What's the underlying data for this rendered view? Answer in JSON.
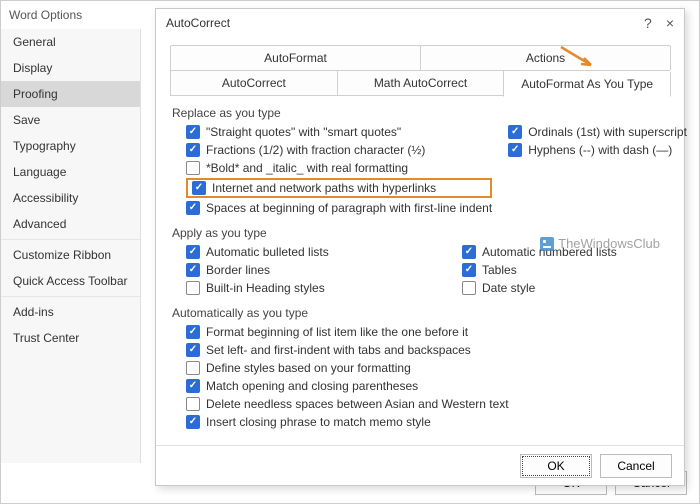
{
  "word_options": {
    "title": "Word Options",
    "sidebar": {
      "items": [
        "General",
        "Display",
        "Proofing",
        "Save",
        "Typography",
        "Language",
        "Accessibility",
        "Advanced"
      ],
      "items2": [
        "Customize Ribbon",
        "Quick Access Toolbar"
      ],
      "items3": [
        "Add-ins",
        "Trust Center"
      ],
      "active": "Proofing"
    },
    "footer": {
      "ok": "OK",
      "cancel": "Cancel"
    }
  },
  "autocorrect": {
    "title": "AutoCorrect",
    "tabs_row1": [
      "AutoFormat",
      "Actions"
    ],
    "tabs_row2": [
      "AutoCorrect",
      "Math AutoCorrect",
      "AutoFormat As You Type"
    ],
    "active_tab": "AutoFormat As You Type",
    "sections": {
      "replace": {
        "label": "Replace as you type",
        "left": [
          {
            "label": "\"Straight quotes\" with \"smart quotes\"",
            "checked": true
          },
          {
            "label": "Fractions (1/2) with fraction character (½)",
            "checked": true
          },
          {
            "label": "*Bold* and _italic_ with real formatting",
            "checked": false
          },
          {
            "label": "Internet and network paths with hyperlinks",
            "checked": true,
            "highlight": true
          },
          {
            "label": "Spaces at beginning of paragraph with first-line indent",
            "checked": true
          }
        ],
        "right": [
          {
            "label": "Ordinals (1st) with superscript",
            "checked": true
          },
          {
            "label": "Hyphens (--) with dash (—)",
            "checked": true
          }
        ]
      },
      "apply": {
        "label": "Apply as you type",
        "left": [
          {
            "label": "Automatic bulleted lists",
            "checked": true
          },
          {
            "label": "Border lines",
            "checked": true
          },
          {
            "label": "Built-in Heading styles",
            "checked": false
          }
        ],
        "right": [
          {
            "label": "Automatic numbered lists",
            "checked": true
          },
          {
            "label": "Tables",
            "checked": true
          },
          {
            "label": "Date style",
            "checked": false
          }
        ]
      },
      "auto": {
        "label": "Automatically as you type",
        "items": [
          {
            "label": "Format beginning of list item like the one before it",
            "checked": true
          },
          {
            "label": "Set left- and first-indent with tabs and backspaces",
            "checked": true
          },
          {
            "label": "Define styles based on your formatting",
            "checked": false
          },
          {
            "label": "Match opening and closing parentheses",
            "checked": true
          },
          {
            "label": "Delete needless spaces between Asian and Western text",
            "checked": false
          },
          {
            "label": "Insert closing phrase to match memo style",
            "checked": true
          }
        ]
      }
    },
    "footer": {
      "ok": "OK",
      "cancel": "Cancel"
    }
  },
  "watermark": "TheWindowsClub"
}
